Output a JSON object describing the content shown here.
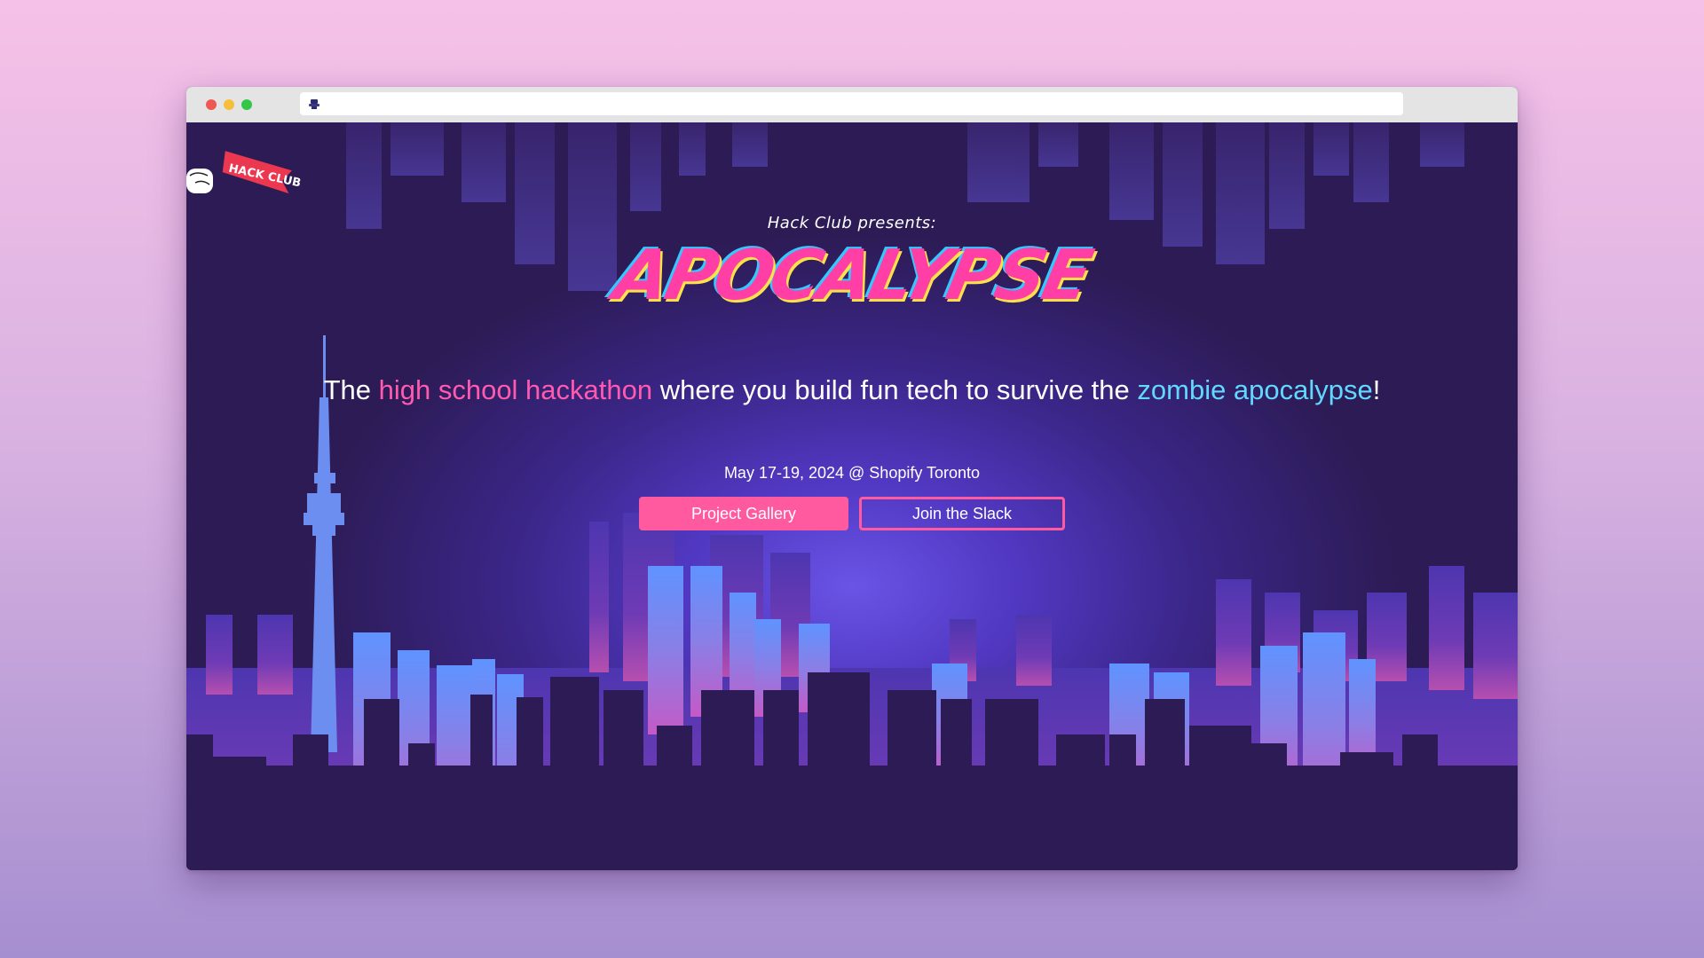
{
  "browser": {
    "url": ""
  },
  "page": {
    "presents": "Hack Club presents:",
    "logo_text": "APOCALYPSE",
    "flag_text": "HACK CLUB",
    "headline": {
      "part1": "The ",
      "highlight1": "high school hackathon",
      "part2": " where you build fun tech to survive the ",
      "highlight2": "zombie apocalypse",
      "part3": "!"
    },
    "date_location": "May 17-19, 2024 @ Shopify Toronto",
    "buttons": {
      "gallery": "Project Gallery",
      "slack": "Join the Slack"
    }
  },
  "colors": {
    "accent_pink": "#ff5aa0",
    "accent_cyan": "#62d7ff",
    "background_dark": "#2c1b54"
  }
}
